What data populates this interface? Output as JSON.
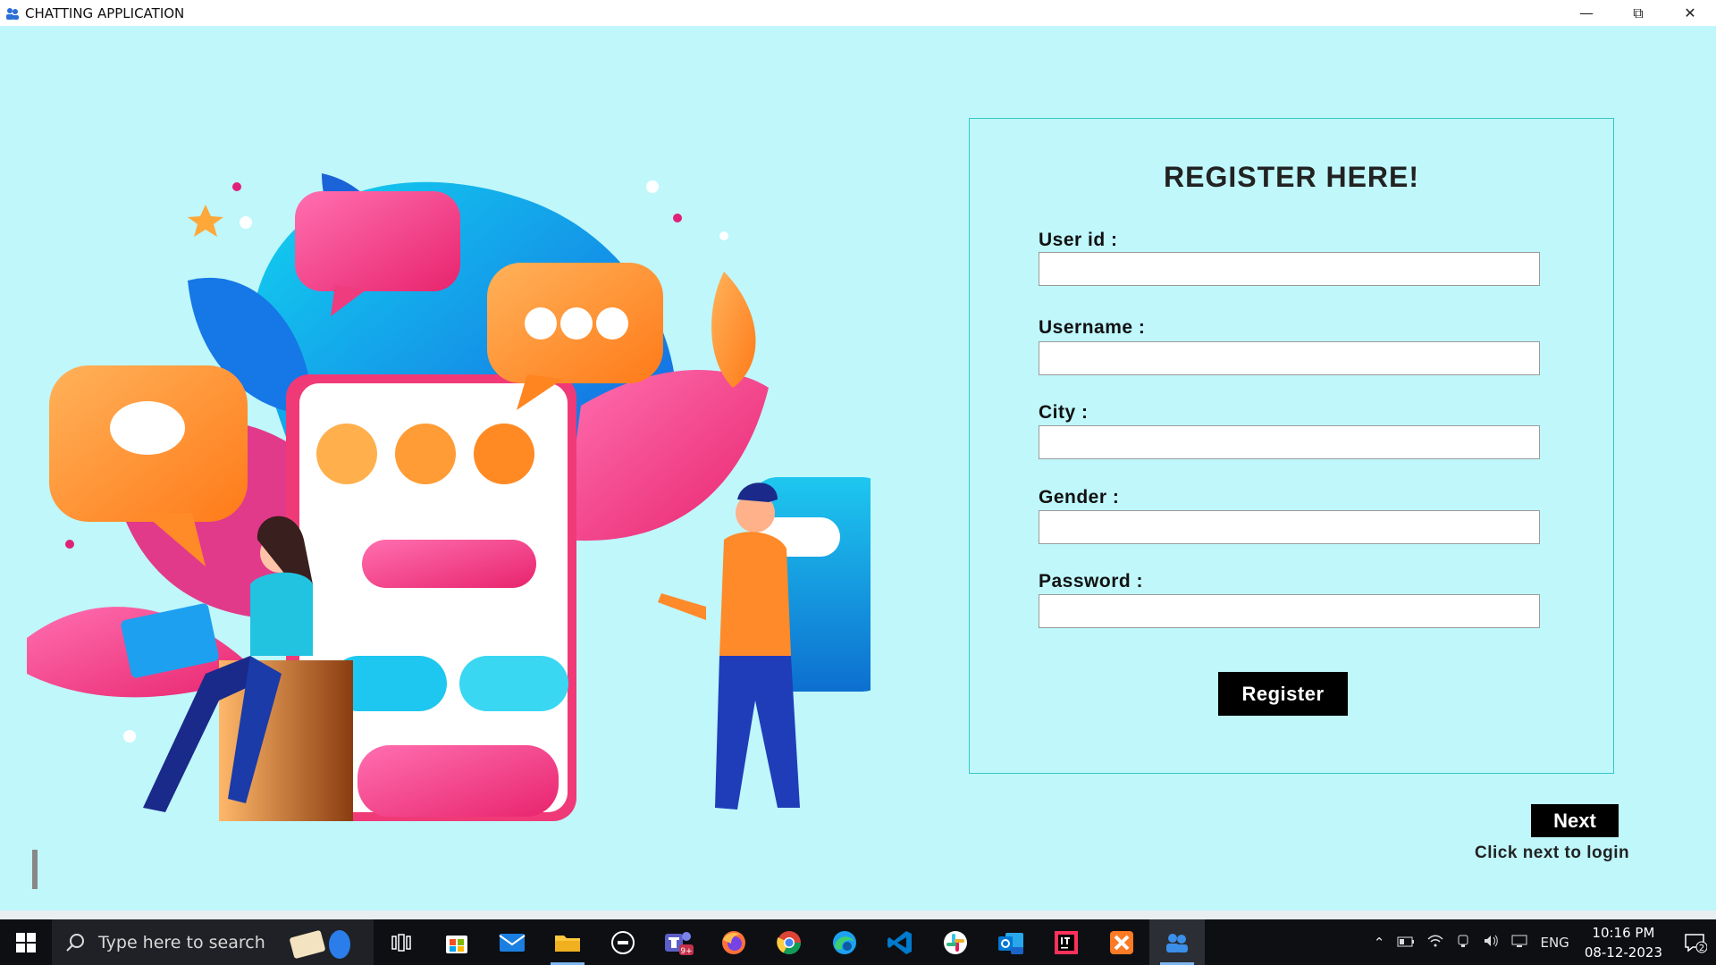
{
  "window": {
    "title": "CHATTING APPLICATION",
    "minimize_glyph": "—",
    "restore_glyph": "⧉",
    "close_glyph": "✕"
  },
  "form": {
    "heading": "REGISTER HERE!",
    "fields": [
      {
        "label": "User id :",
        "value": ""
      },
      {
        "label": "Username :",
        "value": ""
      },
      {
        "label": "City :",
        "value": ""
      },
      {
        "label": "Gender :",
        "value": ""
      },
      {
        "label": "Password :",
        "value": ""
      }
    ],
    "register_label": "Register"
  },
  "nav": {
    "next_label": "Next",
    "next_hint": "Click next to login"
  },
  "taskbar": {
    "search_placeholder": "Type here to search",
    "teams_badge": "9+",
    "language": "ENG",
    "time": "10:16 PM",
    "date": "08-12-2023",
    "notification_count": "2",
    "apps": [
      "task-view",
      "store",
      "mail",
      "file-explorer",
      "dell",
      "teams",
      "firefox",
      "chrome",
      "edge",
      "vscode",
      "slack",
      "outlook-new",
      "intellij",
      "xampp",
      "chatting-app"
    ]
  },
  "colors": {
    "background": "#bff7fb",
    "panel_border": "#36c7c7",
    "button": "#000000",
    "button_text": "#ffffff"
  }
}
